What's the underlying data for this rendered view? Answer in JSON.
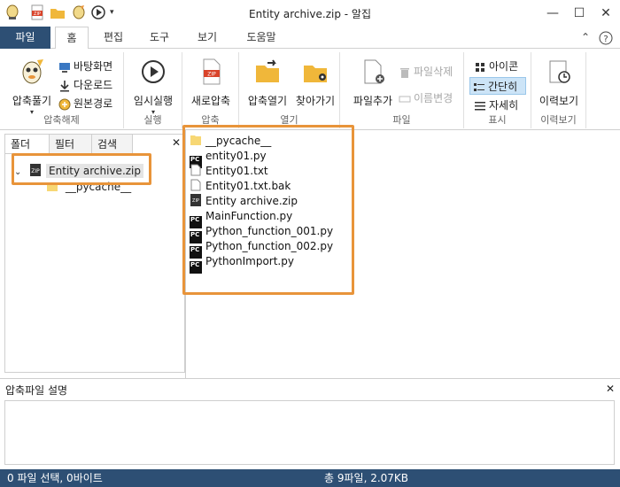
{
  "window": {
    "title": "Entity archive.zip - 알집",
    "controls": {
      "minimize": "—",
      "maximize": "☐",
      "close": "✕"
    }
  },
  "tabs": {
    "file": "파일",
    "items": [
      "홈",
      "편집",
      "도구",
      "보기",
      "도움말"
    ],
    "active": "홈"
  },
  "ribbon": {
    "extract": {
      "big": "압축풀기",
      "desktop": "바탕화면",
      "downloads": "다운로드",
      "original": "원본경로",
      "group": "압축해제"
    },
    "run": {
      "big": "임시실행",
      "group": "실행"
    },
    "compress": {
      "big": "새로압축",
      "group": "압축"
    },
    "open": {
      "open_archive": "압축열기",
      "find": "찾아가기",
      "group": "열기"
    },
    "file": {
      "add": "파일추가",
      "delete": "파일삭제",
      "rename": "이름변경",
      "group": "파일"
    },
    "view": {
      "icon": "아이콘",
      "simple": "간단히",
      "detail": "자세히",
      "group": "표시"
    },
    "history": {
      "big": "이력보기",
      "group": "이력보기"
    },
    "colors": {
      "accent": "#2d4f74",
      "highlight": "#e8943a",
      "selected": "#cce4f7"
    }
  },
  "left_pane": {
    "tabs": [
      "폴더",
      "필터",
      "검색"
    ],
    "tree": {
      "root": "Entity archive.zip",
      "child": "__pycache__"
    }
  },
  "file_list": [
    {
      "name": "__pycache__",
      "icon": "folder-icon"
    },
    {
      "name": "entity01.py",
      "icon": "pycharm-icon"
    },
    {
      "name": "Entity01.txt",
      "icon": "text-file-icon"
    },
    {
      "name": "Entity01.txt.bak",
      "icon": "text-file-icon"
    },
    {
      "name": "Entity archive.zip",
      "icon": "zip-icon"
    },
    {
      "name": "MainFunction.py",
      "icon": "pycharm-icon"
    },
    {
      "name": "Python_function_001.py",
      "icon": "pycharm-icon"
    },
    {
      "name": "Python_function_002.py",
      "icon": "pycharm-icon"
    },
    {
      "name": "PythonImport.py",
      "icon": "pycharm-icon"
    }
  ],
  "description": {
    "title": "압축파일 설명",
    "close": "✕"
  },
  "status": {
    "left": "0 파일 선택,  0바이트",
    "right": "총 9파일,  2.07KB"
  }
}
